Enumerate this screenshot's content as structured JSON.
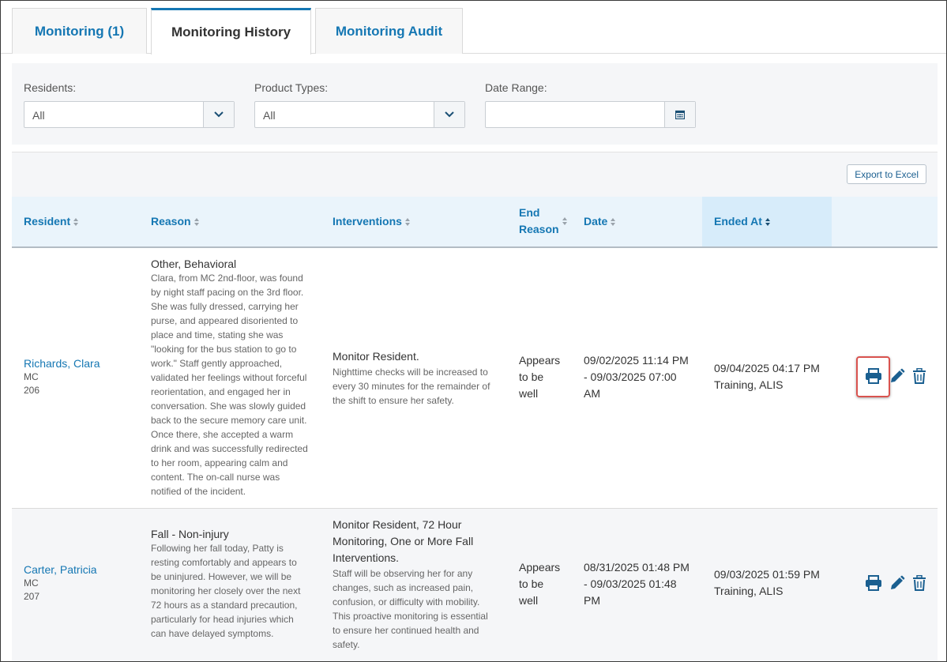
{
  "tabs": [
    {
      "label": "Monitoring  (1)",
      "active": false
    },
    {
      "label": "Monitoring History",
      "active": true
    },
    {
      "label": "Monitoring Audit",
      "active": false
    }
  ],
  "filters": {
    "residents": {
      "label": "Residents:",
      "value": "All"
    },
    "product_types": {
      "label": "Product Types:",
      "value": "All"
    },
    "date_range": {
      "label": "Date Range:",
      "value": ""
    }
  },
  "toolbar": {
    "export_label": "Export to Excel"
  },
  "columns": {
    "resident": "Resident",
    "reason": "Reason",
    "interventions": "Interventions",
    "end_reason_line1": "End",
    "end_reason_line2": "Reason",
    "date": "Date",
    "ended_at": "Ended At"
  },
  "rows": [
    {
      "resident_name": "Richards, Clara",
      "resident_unit": "MC",
      "resident_room": "206",
      "reason_title": "Other, Behavioral",
      "reason_lines": [
        "Clara, from MC 2nd-floor, was found",
        "by night staff pacing on the 3rd floor.",
        "She was fully dressed, carrying her",
        "purse, and appeared disoriented to",
        "place and time, stating she was",
        "\"looking for the bus station to go to",
        "work.\" Staff gently approached,",
        "validated her feelings without forceful",
        "reorientation, and engaged her in",
        "conversation. She was slowly guided",
        "back to the secure memory care unit.",
        "Once there, she accepted a warm",
        "drink and was successfully redirected",
        "to her room, appearing calm and",
        "content. The on-call nurse was",
        "notified of the incident."
      ],
      "intervention_title_lines": [
        "Monitor Resident."
      ],
      "intervention_lines": [
        "Nighttime checks will be increased to",
        "every 30 minutes for the remainder of",
        "the shift to ensure her safety."
      ],
      "end_reason_lines": [
        "Appears",
        "to be",
        "well"
      ],
      "date_lines": [
        "09/02/2025 11:14 PM",
        "- 09/03/2025 07:00",
        "AM"
      ],
      "ended_at_lines": [
        "09/04/2025 04:17 PM",
        "Training, ALIS"
      ]
    },
    {
      "resident_name": "Carter, Patricia",
      "resident_unit": "MC",
      "resident_room": "207",
      "reason_title": "Fall - Non-injury",
      "reason_lines": [
        "Following her fall today, Patty is",
        "resting comfortably and appears to",
        "be uninjured. However, we will be",
        "monitoring her closely over the next",
        "72 hours as a standard precaution,",
        "particularly for head injuries which",
        "can have delayed symptoms."
      ],
      "intervention_title_lines": [
        "Monitor Resident, 72 Hour",
        "Monitoring, One or More Fall",
        "Interventions."
      ],
      "intervention_lines": [
        "Staff will be observing her for any",
        "changes, such as increased pain,",
        "confusion, or difficulty with mobility.",
        "This proactive monitoring is essential",
        "to ensure her continued health and",
        "safety."
      ],
      "end_reason_lines": [
        "Appears",
        "to be",
        "well"
      ],
      "date_lines": [
        "08/31/2025 01:48 PM",
        "- 09/03/2025 01:48",
        "PM"
      ],
      "ended_at_lines": [
        "09/03/2025 01:59 PM",
        "Training, ALIS"
      ]
    }
  ],
  "colors": {
    "accent": "#1577b3",
    "highlight": "#d9534f"
  }
}
